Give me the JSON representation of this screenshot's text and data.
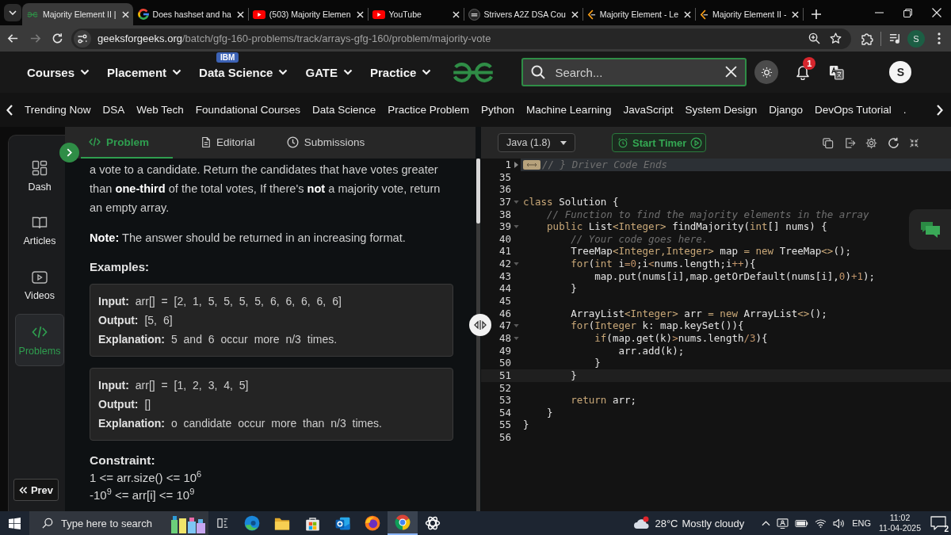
{
  "browser": {
    "tabs": [
      {
        "title": "Majority Element II |",
        "kind": "gfg",
        "selected": true
      },
      {
        "title": "Does hashset and ha",
        "kind": "google",
        "selected": false
      },
      {
        "title": "(503) Majority Elemen",
        "kind": "youtube",
        "selected": false
      },
      {
        "title": "YouTube",
        "kind": "youtube",
        "selected": false
      },
      {
        "title": "Strivers A2Z DSA Cou",
        "kind": "tuf",
        "selected": false
      },
      {
        "title": "Majority Element - Le",
        "kind": "leetcode",
        "selected": false
      },
      {
        "title": "Majority Element II -",
        "kind": "leetcode",
        "selected": false
      }
    ],
    "forward_disabled": true,
    "url_host": "geeksforgeeks.org",
    "url_path": "/batch/gfg-160-problems/track/arrays-gfg-160/problem/majority-vote",
    "profile": "S"
  },
  "site_nav": {
    "menu": [
      {
        "label": "Courses"
      },
      {
        "label": "Placement"
      },
      {
        "label": "Data Science",
        "badge": "IBM"
      },
      {
        "label": "GATE"
      },
      {
        "label": "Practice"
      }
    ],
    "search": {
      "placeholder": "Search..."
    },
    "notification_count": "1",
    "avatar": "S"
  },
  "trending": [
    "Trending Now",
    "DSA",
    "Web Tech",
    "Foundational Courses",
    "Data Science",
    "Practice Problem",
    "Python",
    "Machine Learning",
    "JavaScript",
    "System Design",
    "Django",
    "DevOps Tutorial",
    "."
  ],
  "sidebar": {
    "items": [
      {
        "label": "Dash",
        "kind": "dash",
        "selected": false
      },
      {
        "label": "Articles",
        "kind": "articles",
        "selected": false
      },
      {
        "label": "Videos",
        "kind": "videos",
        "selected": false
      },
      {
        "label": "Problems",
        "kind": "problems",
        "selected": true
      }
    ],
    "prev": "Prev"
  },
  "problem": {
    "tabs": [
      {
        "label": "Problem",
        "kind": "problem",
        "selected": true
      },
      {
        "label": "Editorial",
        "kind": "editorial",
        "selected": false
      },
      {
        "label": "Submissions",
        "kind": "submissions",
        "selected": false
      }
    ],
    "paragraphs": [
      "a vote to a candidate. Return the candidates that have votes greater than **one-third** of the total votes, If there's **not** a majority vote, return an empty array.",
      "**Note:** The answer should be returned in an increasing format."
    ],
    "examples_title": "Examples:",
    "examples": [
      [
        "**Input:** arr[] = [2, 1, 5, 5, 5, 5, 6, 6, 6, 6, 6]",
        "**Output:** [5, 6]",
        "**Explanation:** 5 and 6 occur more n/3 times."
      ],
      [
        "**Input:** arr[] = [1, 2, 3, 4, 5]",
        "**Output:** []",
        "**Explanation:** o candidate occur more than n/3 times."
      ]
    ],
    "constraints_title": "Constraint:",
    "constraints": [
      "1 <= arr.size() <= 10$^{6}$",
      "-10$^{9}$ <= arr[i] <= 10$^{9}$"
    ]
  },
  "editor": {
    "language": "Java (1.8)",
    "timer_button": "Start Timer",
    "lines": [
      {
        "number": "1",
        "foldable": true,
        "folded": true,
        "current": false,
        "tokens": [
          {
            "text": "// } Driver Code Ends",
            "kind": "comment"
          }
        ]
      },
      {
        "number": "35",
        "foldable": false,
        "folded": false,
        "current": false
      },
      {
        "number": "36",
        "foldable": false,
        "folded": false,
        "current": false
      },
      {
        "number": "37",
        "foldable": true,
        "folded": false,
        "current": false,
        "tokens": [
          {
            "text": "class",
            "kind": "keyword"
          },
          {
            "text": " Solution {",
            "kind": "plain"
          }
        ]
      },
      {
        "number": "38",
        "foldable": false,
        "folded": false,
        "current": false,
        "tokens": [
          {
            "text": "    // Function to find the majority elements in the array",
            "kind": "comment"
          }
        ]
      },
      {
        "number": "39",
        "foldable": true,
        "folded": false,
        "current": false,
        "tokens": [
          {
            "text": "    public",
            "kind": "keyword"
          },
          {
            "text": " List",
            "kind": "plain"
          },
          {
            "text": "<Integer>",
            "kind": "keyword"
          },
          {
            "text": " findMajority(",
            "kind": "plain"
          },
          {
            "text": "int",
            "kind": "keyword"
          },
          {
            "text": "[] nums) {",
            "kind": "plain"
          }
        ]
      },
      {
        "number": "40",
        "foldable": false,
        "folded": false,
        "current": false,
        "tokens": [
          {
            "text": "        // Your code goes here.",
            "kind": "comment"
          }
        ]
      },
      {
        "number": "41",
        "foldable": false,
        "folded": false,
        "current": false,
        "tokens": [
          {
            "text": "        TreeMap",
            "kind": "plain"
          },
          {
            "text": "<Integer,Integer>",
            "kind": "keyword"
          },
          {
            "text": " map ",
            "kind": "plain"
          },
          {
            "text": "= new",
            "kind": "keyword"
          },
          {
            "text": " TreeMap",
            "kind": "plain"
          },
          {
            "text": "<>",
            "kind": "keyword"
          },
          {
            "text": "();",
            "kind": "plain"
          }
        ]
      },
      {
        "number": "42",
        "foldable": true,
        "folded": false,
        "current": false,
        "tokens": [
          {
            "text": "        for",
            "kind": "keyword"
          },
          {
            "text": "(",
            "kind": "plain"
          },
          {
            "text": "int",
            "kind": "keyword"
          },
          {
            "text": " i",
            "kind": "plain"
          },
          {
            "text": "=0",
            "kind": "literal"
          },
          {
            "text": ";i",
            "kind": "plain"
          },
          {
            "text": "<",
            "kind": "literal"
          },
          {
            "text": "nums.length;i",
            "kind": "plain"
          },
          {
            "text": "++",
            "kind": "literal"
          },
          {
            "text": "){",
            "kind": "plain"
          }
        ]
      },
      {
        "number": "43",
        "foldable": false,
        "folded": false,
        "current": false,
        "tokens": [
          {
            "text": "            map.put(nums[i],map.getOrDefault(nums[i],",
            "kind": "plain"
          },
          {
            "text": "0",
            "kind": "literal"
          },
          {
            "text": ")",
            "kind": "plain"
          },
          {
            "text": "+1",
            "kind": "literal"
          },
          {
            "text": ");",
            "kind": "plain"
          }
        ]
      },
      {
        "number": "44",
        "foldable": false,
        "folded": false,
        "current": false,
        "tokens": [
          {
            "text": "        }",
            "kind": "plain"
          }
        ]
      },
      {
        "number": "45",
        "foldable": false,
        "folded": false,
        "current": false
      },
      {
        "number": "46",
        "foldable": false,
        "folded": false,
        "current": false,
        "tokens": [
          {
            "text": "        ArrayList",
            "kind": "plain"
          },
          {
            "text": "<Integer>",
            "kind": "keyword"
          },
          {
            "text": " arr ",
            "kind": "plain"
          },
          {
            "text": "= new",
            "kind": "keyword"
          },
          {
            "text": " ArrayList",
            "kind": "plain"
          },
          {
            "text": "<>",
            "kind": "keyword"
          },
          {
            "text": "();",
            "kind": "plain"
          }
        ]
      },
      {
        "number": "47",
        "foldable": true,
        "folded": false,
        "current": false,
        "tokens": [
          {
            "text": "        for",
            "kind": "keyword"
          },
          {
            "text": "(",
            "kind": "plain"
          },
          {
            "text": "Integer",
            "kind": "keyword"
          },
          {
            "text": " k: map.keySet()){",
            "kind": "plain"
          }
        ]
      },
      {
        "number": "48",
        "foldable": true,
        "folded": false,
        "current": false,
        "tokens": [
          {
            "text": "            if",
            "kind": "keyword"
          },
          {
            "text": "(map.get(k)",
            "kind": "plain"
          },
          {
            "text": ">",
            "kind": "literal"
          },
          {
            "text": "nums.length",
            "kind": "plain"
          },
          {
            "text": "/3",
            "kind": "literal"
          },
          {
            "text": "){",
            "kind": "plain"
          }
        ]
      },
      {
        "number": "49",
        "foldable": false,
        "folded": false,
        "current": false,
        "tokens": [
          {
            "text": "                arr.add(k);",
            "kind": "plain"
          }
        ]
      },
      {
        "number": "50",
        "foldable": false,
        "folded": false,
        "current": false,
        "tokens": [
          {
            "text": "            }",
            "kind": "plain"
          }
        ]
      },
      {
        "number": "51",
        "foldable": false,
        "folded": false,
        "current": true,
        "tokens": [
          {
            "text": "        }",
            "kind": "plain"
          }
        ]
      },
      {
        "number": "52",
        "foldable": false,
        "folded": false,
        "current": false
      },
      {
        "number": "53",
        "foldable": false,
        "folded": false,
        "current": false,
        "tokens": [
          {
            "text": "        return",
            "kind": "keyword"
          },
          {
            "text": " arr;",
            "kind": "plain"
          }
        ]
      },
      {
        "number": "54",
        "foldable": false,
        "folded": false,
        "current": false,
        "tokens": [
          {
            "text": "    }",
            "kind": "plain"
          }
        ]
      },
      {
        "number": "55",
        "foldable": false,
        "folded": false,
        "current": false,
        "tokens": [
          {
            "text": "}",
            "kind": "plain"
          }
        ]
      },
      {
        "number": "56",
        "foldable": false,
        "folded": false,
        "current": false
      }
    ]
  },
  "taskbar": {
    "search_placeholder": "Type here to search",
    "apps": [
      {
        "kind": "edge",
        "selected": false
      },
      {
        "kind": "explorer",
        "selected": false
      },
      {
        "kind": "store",
        "selected": false
      },
      {
        "kind": "mail",
        "selected": false
      },
      {
        "kind": "firefox",
        "selected": false
      },
      {
        "kind": "chrome",
        "selected": true
      },
      {
        "kind": "chatgpt",
        "selected": false
      }
    ],
    "weather": {
      "temperature": "28°C",
      "condition": "Mostly cloudy"
    },
    "language": "ENG",
    "time": "11:02",
    "date": "11-04-2025",
    "notification_count": "2"
  }
}
